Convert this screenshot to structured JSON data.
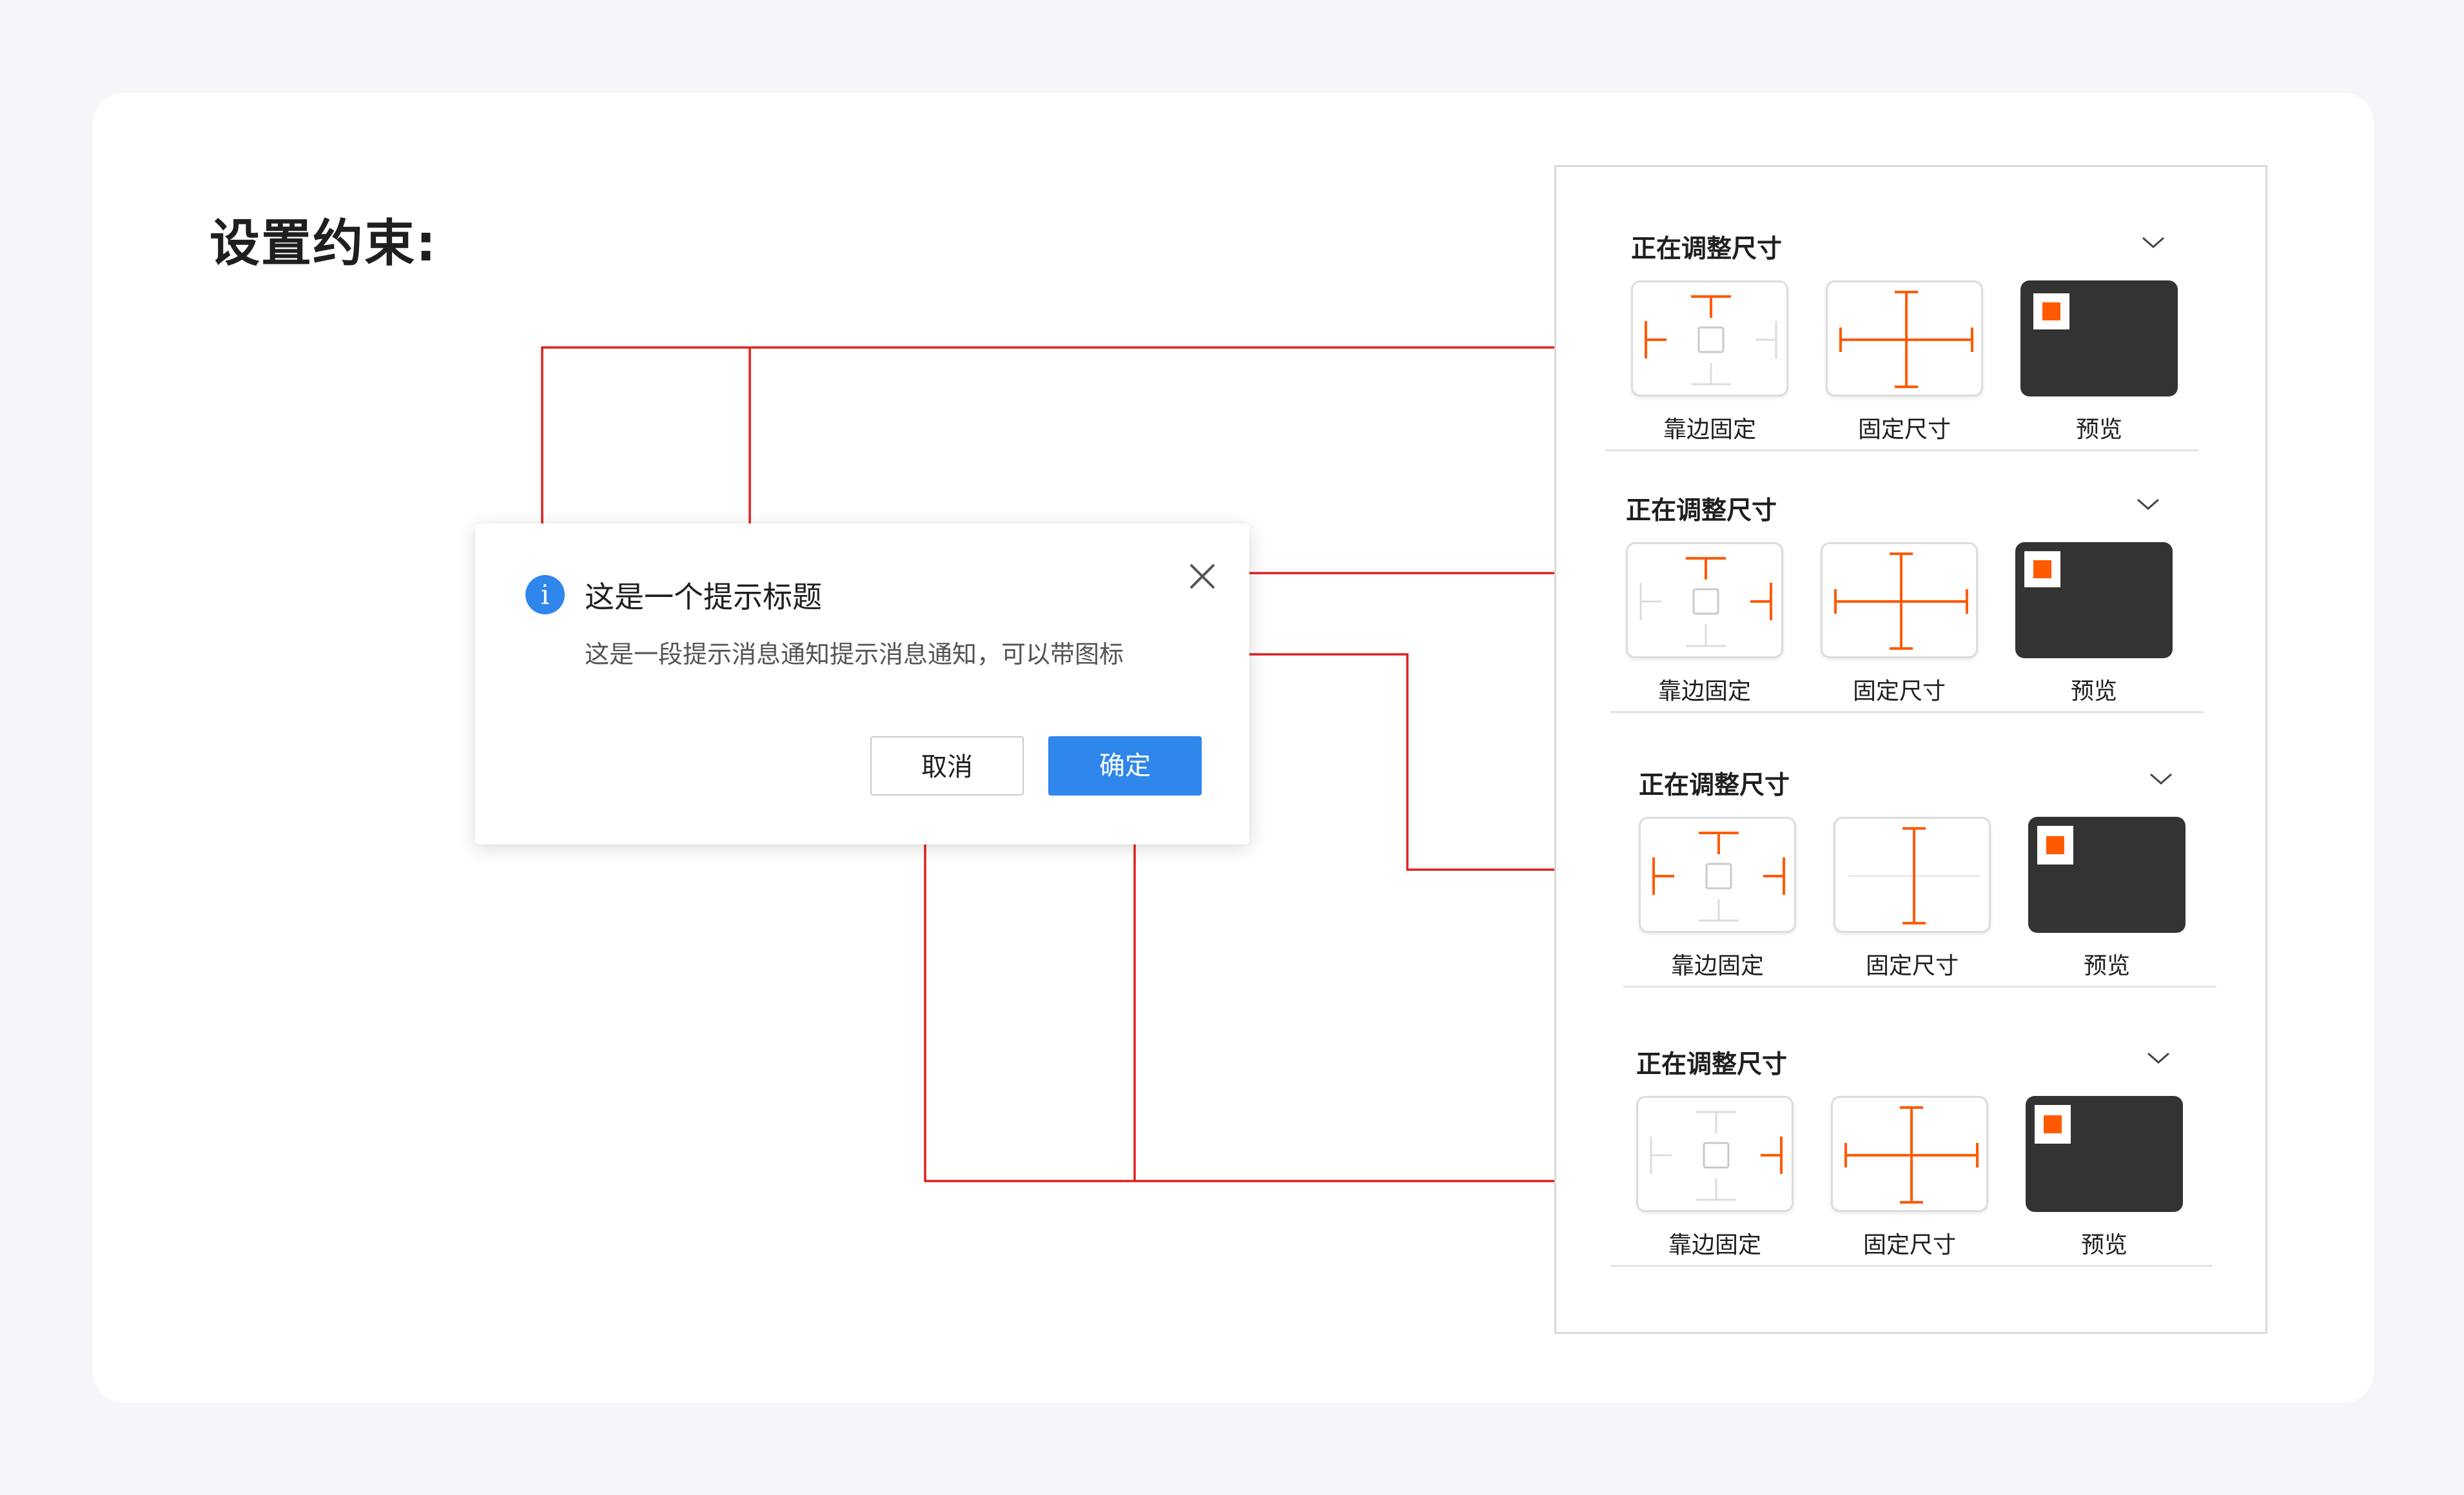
{
  "heading": "设置约束:",
  "dialog": {
    "icon": "info-icon",
    "icon_glyph": "i",
    "title": "这是一个提示标题",
    "message": "这是一段提示消息通知提示消息通知，可以带图标",
    "cancel_label": "取消",
    "ok_label": "确定",
    "close_icon": "close-icon"
  },
  "panel": {
    "sections": [
      {
        "title": "正在调整尺寸",
        "tiles": [
          {
            "label": "靠边固定"
          },
          {
            "label": "固定尺寸"
          },
          {
            "label": "预览"
          }
        ]
      },
      {
        "title": "正在调整尺寸",
        "tiles": [
          {
            "label": "靠边固定"
          },
          {
            "label": "固定尺寸"
          },
          {
            "label": "预览"
          }
        ]
      },
      {
        "title": "正在调整尺寸",
        "tiles": [
          {
            "label": "靠边固定"
          },
          {
            "label": "固定尺寸"
          },
          {
            "label": "预览"
          }
        ]
      },
      {
        "title": "正在调整尺寸",
        "tiles": [
          {
            "label": "靠边固定"
          },
          {
            "label": "固定尺寸"
          },
          {
            "label": "预览"
          }
        ]
      }
    ]
  },
  "colors": {
    "accent_orange": "#ff5a00",
    "connector_red": "#e02020",
    "primary_blue": "#2f86eb",
    "preview_dark": "#333333"
  }
}
